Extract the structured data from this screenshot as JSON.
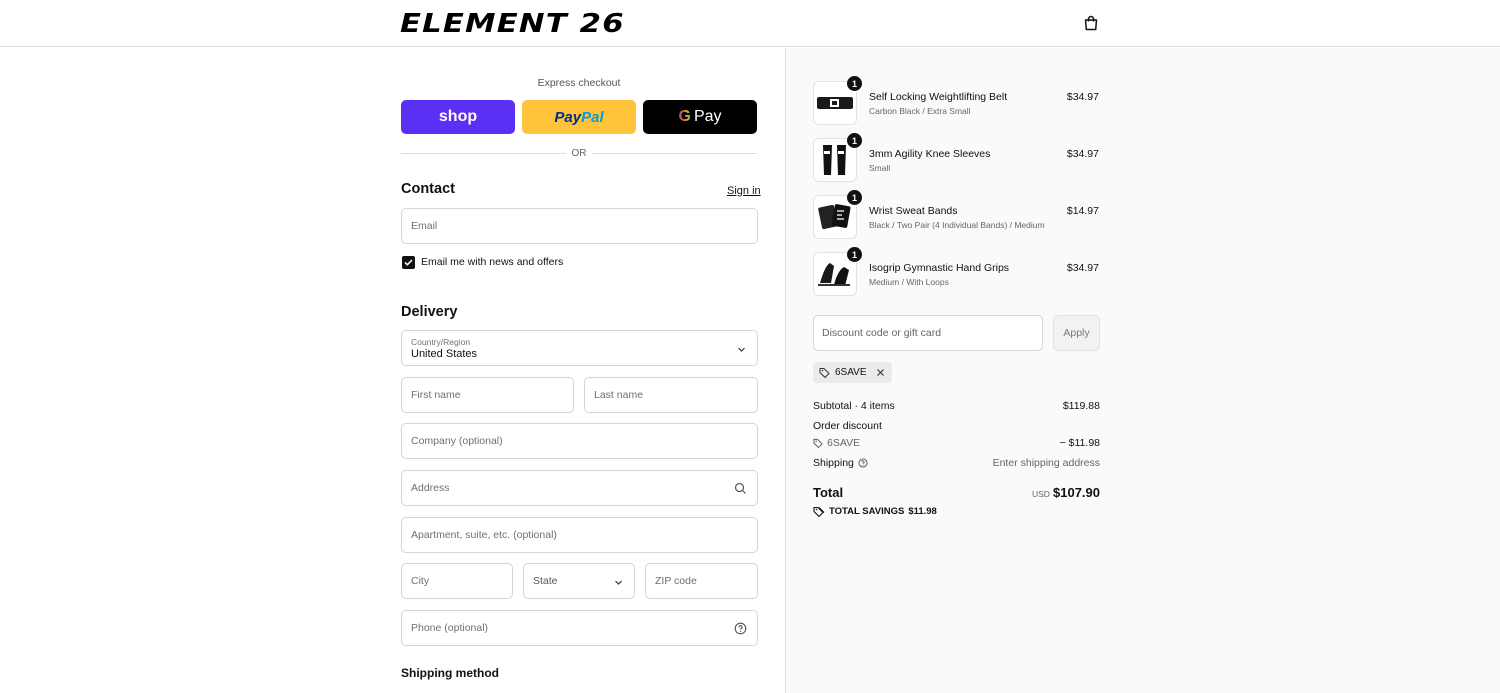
{
  "header": {
    "logo": "ELEMENT 26",
    "cart_icon": "shopping-bag-icon"
  },
  "express": {
    "label": "Express checkout",
    "shop_label": "shop",
    "paypal_label_a": "Pay",
    "paypal_label_b": "Pal",
    "gpay_g": "G",
    "gpay_label": "Pay",
    "or_label": "OR"
  },
  "contact": {
    "title": "Contact",
    "sign_in": "Sign in",
    "email_placeholder": "Email",
    "newsletter_label": "Email me with news and offers",
    "newsletter_checked": true
  },
  "delivery": {
    "title": "Delivery",
    "country_label": "Country/Region",
    "country_value": "United States",
    "first_name_placeholder": "First name",
    "last_name_placeholder": "Last name",
    "company_placeholder": "Company (optional)",
    "address_placeholder": "Address",
    "apartment_placeholder": "Apartment, suite, etc. (optional)",
    "city_placeholder": "City",
    "state_label": "State",
    "zip_placeholder": "ZIP code",
    "phone_placeholder": "Phone (optional)"
  },
  "shipping_method": {
    "title": "Shipping method"
  },
  "summary": {
    "items": [
      {
        "name": "Self Locking Weightlifting Belt",
        "variant": "Carbon Black / Extra Small",
        "price": "$34.97",
        "qty": "1"
      },
      {
        "name": "3mm Agility Knee Sleeves",
        "variant": "Small",
        "price": "$34.97",
        "qty": "1"
      },
      {
        "name": "Wrist Sweat Bands",
        "variant": "Black / Two Pair (4 Individual Bands) / Medium",
        "price": "$14.97",
        "qty": "1"
      },
      {
        "name": "Isogrip Gymnastic Hand Grips",
        "variant": "Medium / With Loops",
        "price": "$34.97",
        "qty": "1"
      }
    ],
    "discount_placeholder": "Discount code or gift card",
    "apply_label": "Apply",
    "applied_code": "6SAVE",
    "subtotal_label": "Subtotal · 4 items",
    "subtotal_value": "$119.88",
    "order_discount_label": "Order discount",
    "discount_code": "6SAVE",
    "discount_value": "− $11.98",
    "shipping_label": "Shipping",
    "shipping_value": "Enter shipping address",
    "total_label": "Total",
    "currency": "USD",
    "total_value": "$107.90",
    "savings_label": "TOTAL SAVINGS",
    "savings_value": "$11.98"
  },
  "colors": {
    "shop_pay": "#5a31f4",
    "paypal": "#ffc439",
    "gpay": "#000000",
    "summary_bg": "#fafafa"
  }
}
